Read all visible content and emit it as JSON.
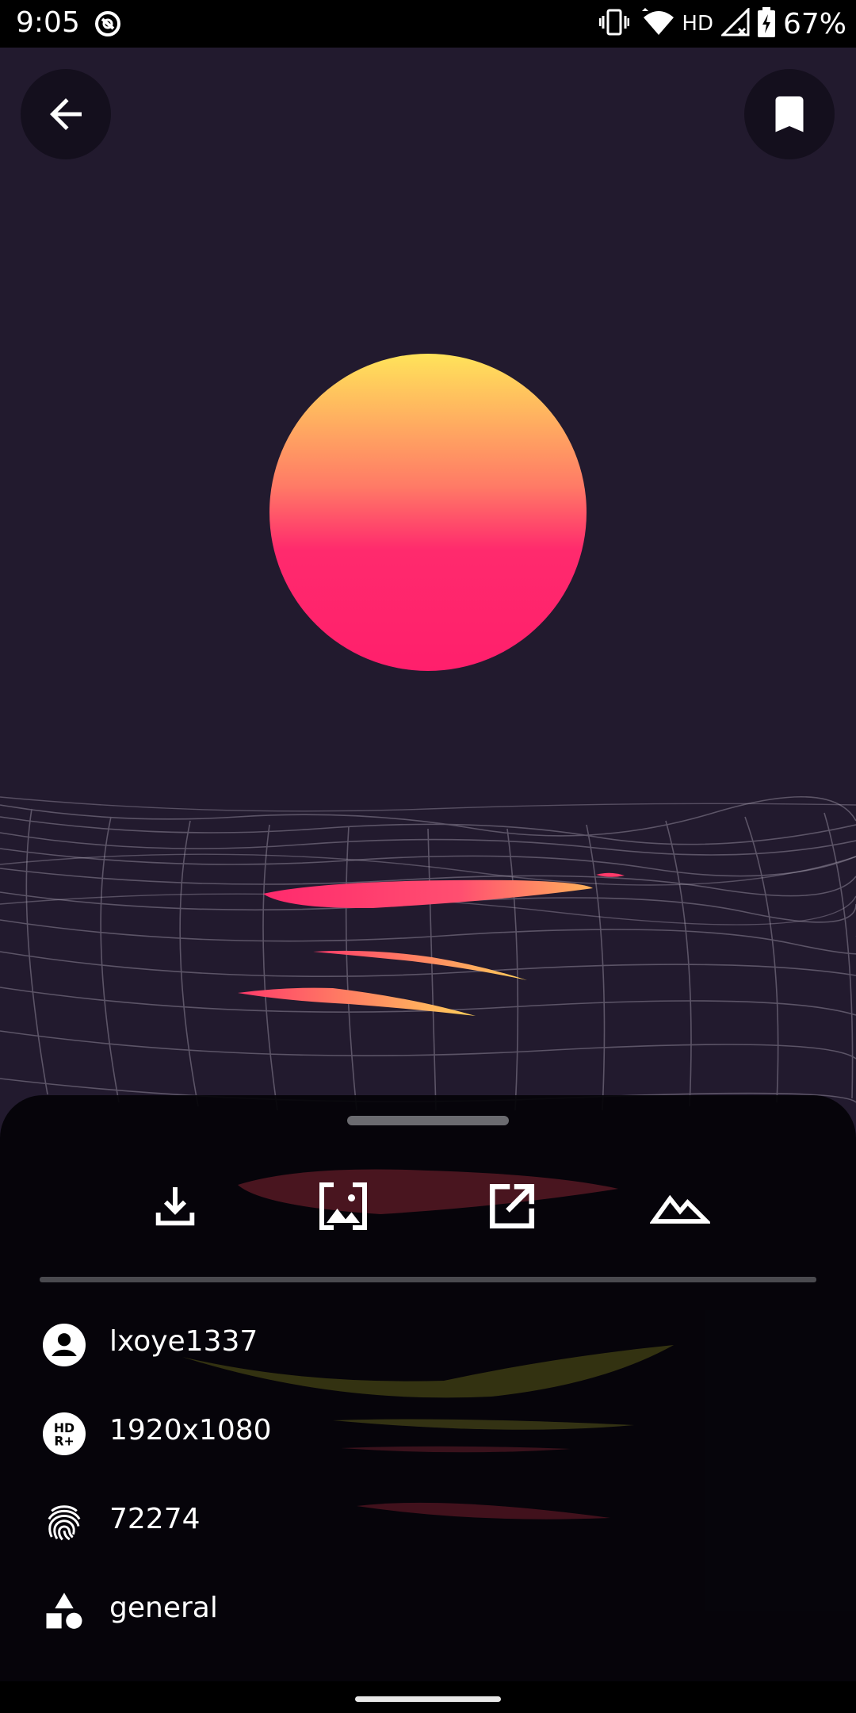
{
  "status_bar": {
    "time": "9:05",
    "network_label": "HD",
    "battery_percent": "67%"
  },
  "toolbar": {
    "back_icon": "arrow-back-icon",
    "bookmark_icon": "bookmark-icon"
  },
  "actions": [
    {
      "name": "download",
      "icon": "download-icon"
    },
    {
      "name": "set-wallpaper",
      "icon": "wallpaper-icon"
    },
    {
      "name": "open-external",
      "icon": "open-in-new-icon"
    },
    {
      "name": "similar",
      "icon": "landscape-icon"
    }
  ],
  "info": {
    "uploader": "lxoye1337",
    "resolution": "1920x1080",
    "id": "72274",
    "category": "general"
  },
  "colors": {
    "background": "#221a2e",
    "sun_top": "#ffe35a",
    "sun_bottom": "#ff2a6d",
    "sheet": "#040308"
  }
}
